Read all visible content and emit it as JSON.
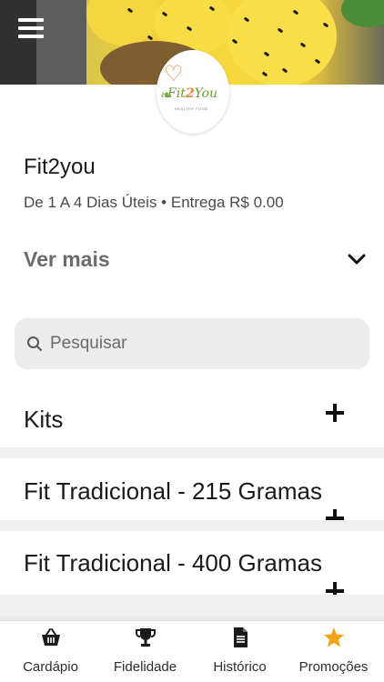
{
  "header": {
    "menu_icon": "hamburger-menu-icon",
    "logo": {
      "brand_part1": "Fit",
      "brand_part2": "2",
      "brand_part3": "You",
      "tagline": "HEALTHY FOOD"
    }
  },
  "store": {
    "name": "Fit2you",
    "info": "De 1 A 4 Dias Úteis • Entrega R$ 0.00",
    "ver_mais_label": "Ver mais",
    "ver_mais_icon": "chevron-down-icon"
  },
  "search": {
    "placeholder": "Pesquisar",
    "value": "",
    "icon": "search-icon"
  },
  "categories": [
    {
      "label": "Kits",
      "icon": "plus-icon"
    },
    {
      "label": "Fit Tradicional - 215 Gramas",
      "icon": "plus-icon"
    },
    {
      "label": "Fit Tradicional - 400 Gramas",
      "icon": "plus-icon"
    }
  ],
  "bottom_nav": {
    "items": [
      {
        "label": "Cardápio",
        "icon": "basket-icon",
        "color": "#1a1a1a"
      },
      {
        "label": "Fidelidade",
        "icon": "trophy-icon",
        "color": "#1a1a1a"
      },
      {
        "label": "Histórico",
        "icon": "document-icon",
        "color": "#1a1a1a"
      },
      {
        "label": "Promoções",
        "icon": "star-icon",
        "color": "#f2a51a"
      }
    ]
  }
}
